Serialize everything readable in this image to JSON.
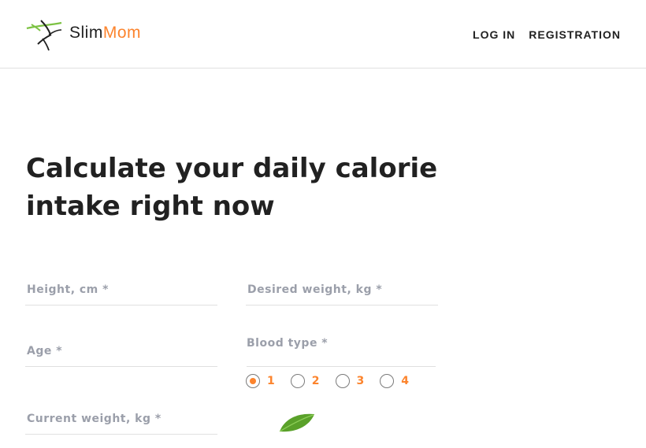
{
  "header": {
    "logo_slim": "Slim",
    "logo_mom": "Mom",
    "nav": {
      "login": "LOG IN",
      "registration": "REGISTRATION"
    }
  },
  "main": {
    "title_line1": "Calculate your daily calorie",
    "title_line2": "intake right now"
  },
  "form": {
    "height_label": "Height, cm *",
    "desired_weight_label": "Desired weight, kg *",
    "age_label": "Age *",
    "blood_type_label": "Blood type *",
    "current_weight_label": "Current weight, kg *",
    "blood_types": [
      "1",
      "2",
      "3",
      "4"
    ],
    "selected_blood_type": "1"
  },
  "colors": {
    "accent": "#fc842d",
    "label_gray": "#9b9faa",
    "text_dark": "#212121",
    "leaf_green": "#5aa12a"
  },
  "icons": {
    "logo": "slimmom-logo-icon",
    "decoration": "leaf-icon"
  }
}
